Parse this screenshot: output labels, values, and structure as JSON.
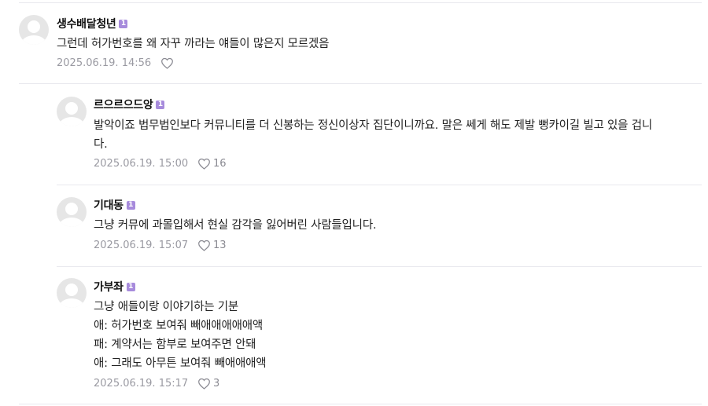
{
  "comments": [
    {
      "nickname": "생수배달청년",
      "level": "1",
      "lines": [
        "그런데 허가번호를 왜 자꾸 까라는 얘들이 많은지 모르겠음"
      ],
      "date": "2025.06.19. 14:56",
      "likes": ""
    },
    {
      "nickname": "르으르으드앙",
      "level": "1",
      "lines": [
        "발악이죠 법무법인보다 커뮤니티를 더 신봉하는 정신이상자 집단이니까요. 말은 쎄게 해도 제발 뻥카이길 빌고 있을 겁니",
        "다."
      ],
      "date": "2025.06.19. 15:00",
      "likes": "16"
    },
    {
      "nickname": "기대동",
      "level": "1",
      "lines": [
        "그냥 커뮤에 과몰입해서 현실 감각을 잃어버린 사람들입니다."
      ],
      "date": "2025.06.19. 15:07",
      "likes": "13"
    },
    {
      "nickname": "가부좌",
      "level": "1",
      "lines": [
        "그냥 애들이랑 이야기하는 기분",
        "애: 허가번호 보여줘 빼애애애애애액",
        "패: 계약서는 함부로 보여주면 안돼",
        "애: 그래도 아무튼 보여줘 빼애애애액"
      ],
      "date": "2025.06.19. 15:17",
      "likes": "3"
    }
  ],
  "icons": {
    "avatar": "default-avatar-icon",
    "like": "heart-outline-icon",
    "level": "level-badge-icon"
  },
  "colors": {
    "level_badge": "#a78bdc",
    "meta_text": "#9a9aa2",
    "divider": "#e9e9ee"
  }
}
